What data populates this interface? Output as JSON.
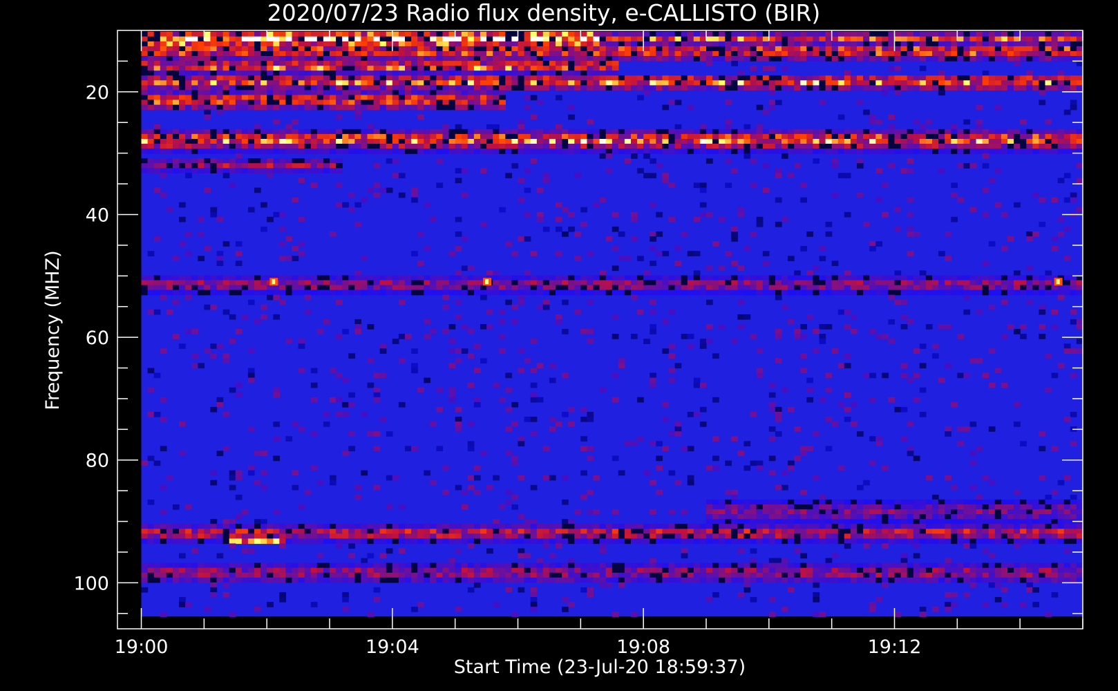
{
  "chart_data": {
    "type": "heatmap",
    "title": "2020/07/23  Radio flux density, e-CALLISTO (BIR)",
    "xlabel": "Start Time (23-Jul-20 18:59:37)",
    "ylabel": "Frequency (MHZ)",
    "x_start_time": "19:00",
    "x_end_time": "19:15",
    "xlim_minutes": [
      -0.38,
      15.0
    ],
    "ylim": [
      107.5,
      10.0
    ],
    "y_data_range": [
      10.2,
      105.5
    ],
    "y_reversed": true,
    "x_ticks": [
      {
        "minute": 0,
        "label": "19:00"
      },
      {
        "minute": 4,
        "label": "19:04"
      },
      {
        "minute": 8,
        "label": "19:08"
      },
      {
        "minute": 12,
        "label": "19:12"
      }
    ],
    "x_minor_step_minutes": 1,
    "y_ticks": [
      20,
      40,
      60,
      80,
      100
    ],
    "y_minor_step": 5,
    "colormap": [
      "#000000",
      "#1010ff",
      "#c01040",
      "#ff4000",
      "#ffff60",
      "#ffffff"
    ],
    "background_color": "#2020e0",
    "emission_bands": [
      {
        "freq": 11,
        "width": 1.5,
        "intensity": 0.95,
        "t_start": 0,
        "t_end": 7.2
      },
      {
        "freq": 11,
        "width": 1.0,
        "intensity": 0.6,
        "t_start": 7.2,
        "t_end": 15
      },
      {
        "freq": 13,
        "width": 1.5,
        "intensity": 0.6,
        "t_start": 0,
        "t_end": 15
      },
      {
        "freq": 15.5,
        "width": 1.0,
        "intensity": 0.7,
        "t_start": 0,
        "t_end": 7.5
      },
      {
        "freq": 18,
        "width": 1.2,
        "intensity": 0.7,
        "t_start": 0,
        "t_end": 15
      },
      {
        "freq": 21,
        "width": 1.5,
        "intensity": 0.6,
        "t_start": 0,
        "t_end": 5.8
      },
      {
        "freq": 27.5,
        "width": 1.5,
        "intensity": 0.7,
        "t_start": 0,
        "t_end": 15
      },
      {
        "freq": 31.5,
        "width": 1.0,
        "intensity": 0.4,
        "t_start": 0,
        "t_end": 3.1
      },
      {
        "freq": 51,
        "width": 1.2,
        "intensity": 0.35,
        "t_start": 0,
        "t_end": 15
      },
      {
        "freq": 91.5,
        "width": 1.2,
        "intensity": 0.5,
        "t_start": 0,
        "t_end": 15
      },
      {
        "freq": 92.5,
        "width": 0.8,
        "intensity": 0.8,
        "t_start": 1.3,
        "t_end": 2.2
      },
      {
        "freq": 98,
        "width": 1.5,
        "intensity": 0.35,
        "t_start": 0,
        "t_end": 15
      },
      {
        "freq": 88,
        "width": 1.5,
        "intensity": 0.3,
        "t_start": 9,
        "t_end": 15
      }
    ],
    "spikes": [
      {
        "minute": 2.1,
        "freq": 51
      },
      {
        "minute": 5.5,
        "freq": 51
      },
      {
        "minute": 14.6,
        "freq": 51
      }
    ]
  }
}
